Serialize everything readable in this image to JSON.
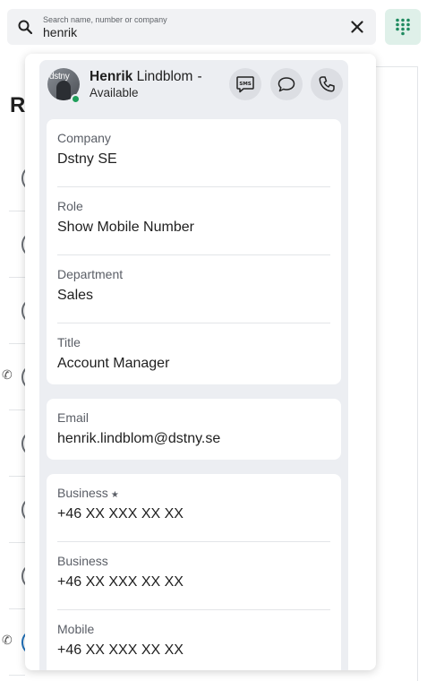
{
  "search": {
    "placeholder": "Search name, number or company",
    "value": "henrik"
  },
  "background": {
    "heading": "R"
  },
  "contact": {
    "first_name": "Henrik",
    "last_name": "Lindblom",
    "name_suffix": "-",
    "status": "Available",
    "status_color": "#1e9e5a",
    "avatar_logo_text": "dstny"
  },
  "actions": {
    "sms_label": "SMS"
  },
  "details": [
    {
      "label": "Company",
      "value": "Dstny SE"
    },
    {
      "label": "Role",
      "value": "Show Mobile Number"
    },
    {
      "label": "Department",
      "value": "Sales"
    },
    {
      "label": "Title",
      "value": "Account Manager"
    }
  ],
  "email": {
    "label": "Email",
    "value": "henrik.lindblom@dstny.se"
  },
  "phones": [
    {
      "label": "Business",
      "value": "+46 XX XXX XX XX",
      "favorite": true
    },
    {
      "label": "Business",
      "value": "+46 XX XXX XX XX",
      "favorite": false
    },
    {
      "label": "Mobile",
      "value": "+46 XX XXX XX XX",
      "favorite": false
    }
  ],
  "icons": {
    "search": "search-icon",
    "clear": "close-icon",
    "dialpad": "dialpad-icon",
    "sms": "sms-icon",
    "chat": "chat-bubble-icon",
    "call": "phone-icon",
    "favorite": "star-icon"
  },
  "colors": {
    "accent": "#1e8a5f",
    "dialpad_bg": "#dff0e9"
  }
}
